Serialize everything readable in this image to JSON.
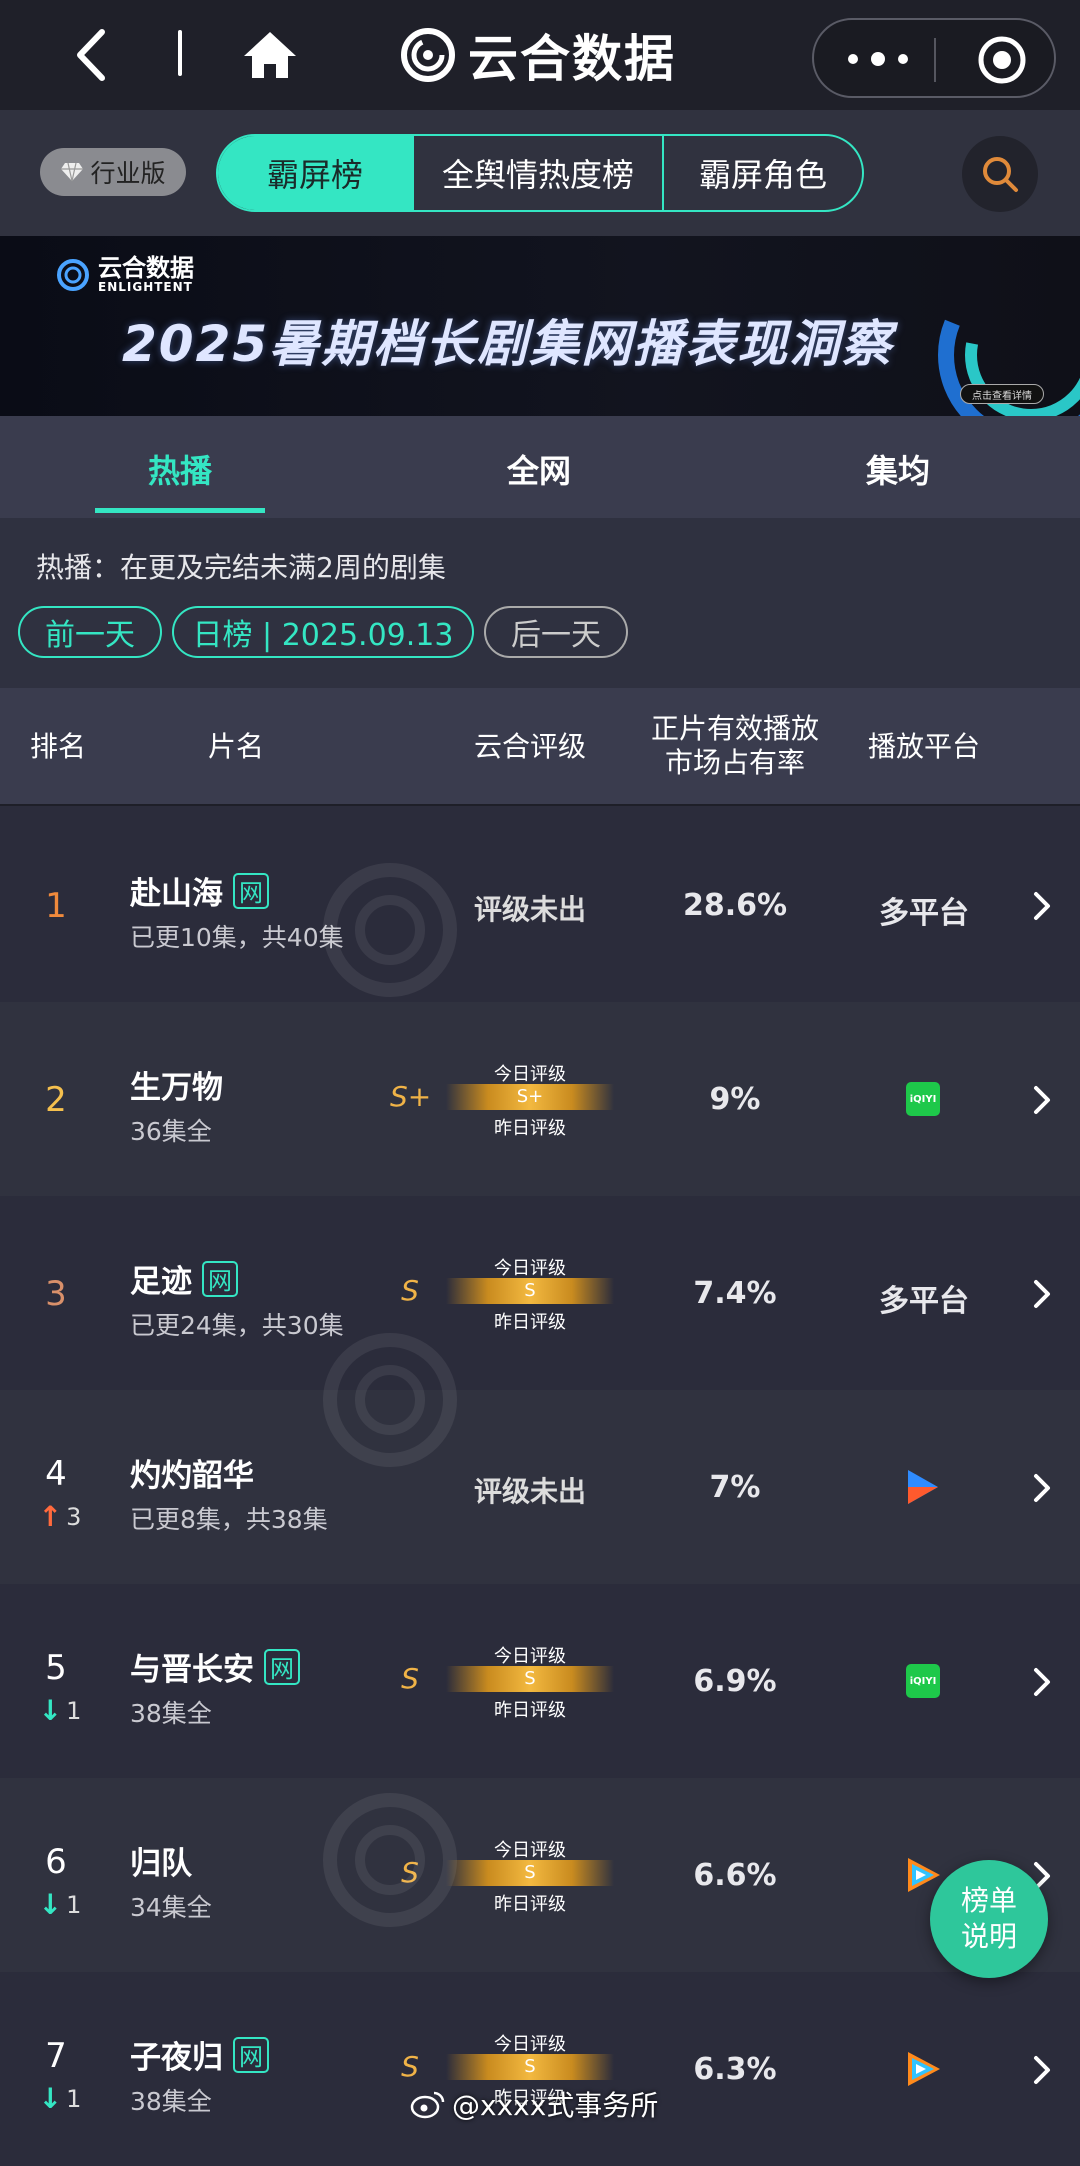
{
  "nav": {
    "brand": "云合数据"
  },
  "tabs": {
    "edition": "行业版",
    "items": [
      "霸屏榜",
      "全舆情热度榜",
      "霸屏角色"
    ]
  },
  "banner": {
    "logo_name": "云合数据",
    "logo_en": "ENLIGHTENT",
    "title": "2025暑期档长剧集网播表现洞察",
    "button": "点击查看详情"
  },
  "subtabs": [
    "热播",
    "全网",
    "集均"
  ],
  "filter": {
    "description": "热播：在更及完结未满2周的剧集",
    "prev": "前一天",
    "current": "日榜 | 2025.09.13",
    "next": "后一天"
  },
  "table_header": {
    "rank": "排名",
    "title": "片名",
    "grade": "云合评级",
    "share_line1": "正片有效播放",
    "share_line2": "市场占有率",
    "platform": "播放平台"
  },
  "gauge_labels": {
    "today": "今日评级",
    "yesterday": "昨日评级"
  },
  "rows": [
    {
      "rank": "1",
      "rank_color": "#f08a3c",
      "change_dir": "",
      "change": "",
      "title": "赴山海",
      "tag": "网",
      "sub": "已更10集，共40集",
      "grade": "",
      "grade_text": "评级未出",
      "share": "28.6%",
      "platform": "多平台",
      "platform_icon": ""
    },
    {
      "rank": "2",
      "rank_color": "#f5c04e",
      "change_dir": "",
      "change": "",
      "title": "生万物",
      "tag": "",
      "sub": "36集全",
      "grade": "S+",
      "grade_text": "",
      "share": "9%",
      "platform": "",
      "platform_icon": "iqiyi-icon"
    },
    {
      "rank": "3",
      "rank_color": "#d9906a",
      "change_dir": "",
      "change": "",
      "title": "足迹",
      "tag": "网",
      "sub": "已更24集，共30集",
      "grade": "S",
      "grade_text": "",
      "share": "7.4%",
      "platform": "多平台",
      "platform_icon": ""
    },
    {
      "rank": "4",
      "rank_color": "#ffffff",
      "change_dir": "up",
      "change": "3",
      "title": "灼灼韶华",
      "tag": "",
      "sub": "已更8集，共38集",
      "grade": "",
      "grade_text": "评级未出",
      "share": "7%",
      "platform": "",
      "platform_icon": "youku-icon"
    },
    {
      "rank": "5",
      "rank_color": "#ffffff",
      "change_dir": "down",
      "change": "1",
      "title": "与晋长安",
      "tag": "网",
      "sub": "38集全",
      "grade": "S",
      "grade_text": "",
      "share": "6.9%",
      "platform": "",
      "platform_icon": "iqiyi-icon"
    },
    {
      "rank": "6",
      "rank_color": "#ffffff",
      "change_dir": "down",
      "change": "1",
      "title": "归队",
      "tag": "",
      "sub": "34集全",
      "grade": "S",
      "grade_text": "",
      "share": "6.6%",
      "platform": "",
      "platform_icon": "tencent-video-icon"
    },
    {
      "rank": "7",
      "rank_color": "#ffffff",
      "change_dir": "down",
      "change": "1",
      "title": "子夜归",
      "tag": "网",
      "sub": "38集全",
      "grade": "S",
      "grade_text": "",
      "share": "6.3%",
      "platform": "",
      "platform_icon": "tencent-video-icon"
    }
  ],
  "float_button": {
    "line1": "榜单",
    "line2": "说明"
  },
  "watermark_weibo": "@xxxx式事务所",
  "colors": {
    "accent": "#34e6c3",
    "gold": "#f0b347"
  }
}
